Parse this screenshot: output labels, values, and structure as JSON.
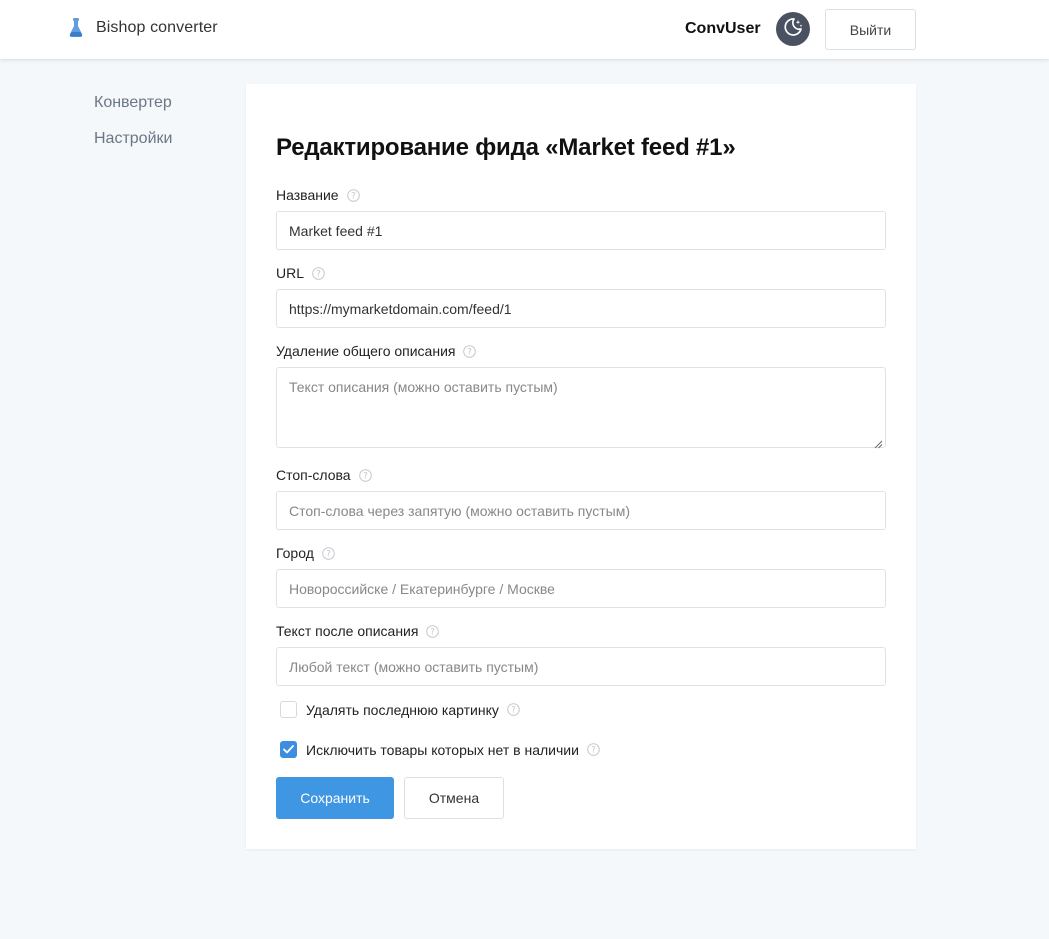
{
  "header": {
    "brand_name": "Bishop converter",
    "username": "ConvUser",
    "logout_label": "Выйти"
  },
  "sidebar": {
    "items": [
      {
        "label": "Конвертер"
      },
      {
        "label": "Настройки"
      }
    ]
  },
  "form": {
    "title": "Редактирование фида «Market feed #1»",
    "fields": {
      "name": {
        "label": "Название",
        "value": "Market feed #1"
      },
      "url": {
        "label": "URL",
        "value": "https://mymarketdomain.com/feed/1"
      },
      "description_removal": {
        "label": "Удаление общего описания",
        "placeholder": "Текст описания (можно оставить пустым)"
      },
      "stopwords": {
        "label": "Стоп-слова",
        "placeholder": "Стоп-слова через запятую (можно оставить пустым)"
      },
      "city": {
        "label": "Город",
        "placeholder": "Новороссийске / Екатеринбурге / Москве"
      },
      "text_after": {
        "label": "Текст после описания",
        "placeholder": "Любой текст (можно оставить пустым)"
      }
    },
    "checkboxes": {
      "remove_last_image": {
        "label": "Удалять последнюю картинку",
        "checked": false
      },
      "exclude_out_of_stock": {
        "label": "Исключить товары которых нет в наличии",
        "checked": true
      }
    },
    "save_label": "Сохранить",
    "cancel_label": "Отмена"
  },
  "colors": {
    "accent": "#3f96e3",
    "background": "#f5f8fa",
    "theme_toggle": "#4a5160"
  },
  "icons": {
    "brand": "flask-icon",
    "theme": "moon-stars-icon",
    "help": "question-circle-icon",
    "check": "checkmark-icon"
  }
}
